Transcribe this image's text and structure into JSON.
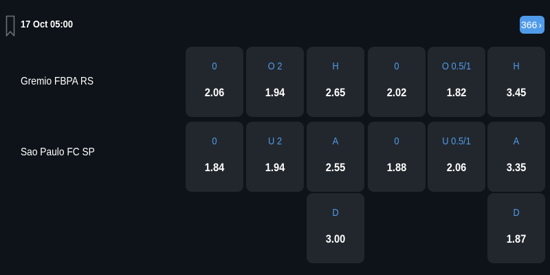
{
  "match": {
    "datetime": "17 Oct 05:00",
    "more_markets": "366",
    "home_team": "Gremio FBPA RS",
    "away_team": "Sao Paulo FC SP"
  },
  "icons": {
    "bookmark": "bookmark-icon",
    "chevron": "chevron-right-icon"
  },
  "colors": {
    "background": "#0e1319",
    "cell": "#22272d",
    "accent": "#4f9bea"
  },
  "odds": {
    "home": [
      {
        "label": "0",
        "odd": "2.06"
      },
      {
        "label": "O 2",
        "odd": "1.94"
      },
      {
        "label": "H",
        "odd": "2.65"
      },
      {
        "label": "0",
        "odd": "2.02"
      },
      {
        "label": "O 0.5/1",
        "odd": "1.82"
      },
      {
        "label": "H",
        "odd": "3.45"
      }
    ],
    "away": [
      {
        "label": "0",
        "odd": "1.84"
      },
      {
        "label": "U 2",
        "odd": "1.94"
      },
      {
        "label": "A",
        "odd": "2.55"
      },
      {
        "label": "0",
        "odd": "1.88"
      },
      {
        "label": "U 0.5/1",
        "odd": "2.06"
      },
      {
        "label": "A",
        "odd": "3.35"
      }
    ],
    "draw": [
      {
        "label": "D",
        "odd": "3.00"
      },
      {
        "label": "D",
        "odd": "1.87"
      }
    ]
  }
}
